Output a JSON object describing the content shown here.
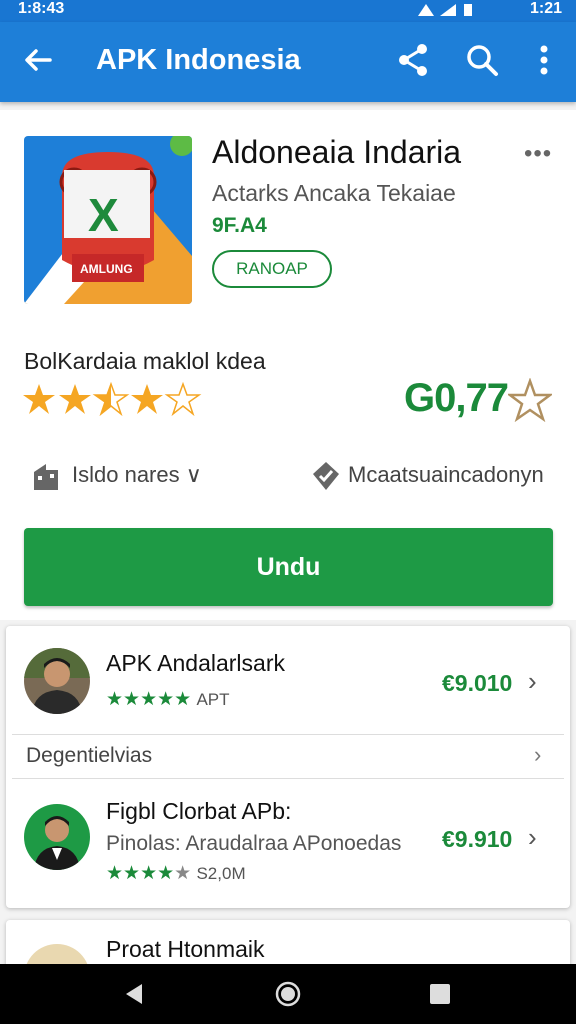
{
  "status_bar": {
    "time_left": "1:8:43",
    "time_right": "1:21",
    "icons": "wifi signal battery"
  },
  "app_bar": {
    "title": "APK Indonesia",
    "back_icon": "arrow-back-icon",
    "share_icon": "share-icon",
    "search_icon": "search-icon",
    "more_icon": "more-vert-icon",
    "color": "#1e7fd8"
  },
  "app": {
    "name": "Aldoneaia Indaria",
    "developer": "Actarks Ancaka Tekaiae",
    "size": "9F.A4",
    "badge": "RANOAP",
    "icon_label": "AMLUNG",
    "icon_letter": "X",
    "menu": "•••"
  },
  "rating": {
    "label": "BolKardaia maklol kdea",
    "stars_filled": 3.5,
    "stars_total": 5,
    "price": "G0,77"
  },
  "info": {
    "left": "Isldo nares",
    "left_caret": "∨",
    "right": "Mcaatsuaincadonyn"
  },
  "download_button": {
    "label": "Undu",
    "color": "#1e9a45"
  },
  "list": {
    "section_header": "Degentielvias",
    "items": [
      {
        "name": "APK Andalarlsark",
        "rating_meta": "APT",
        "stars": "★★★★★",
        "price": "€9.010"
      },
      {
        "name": "Figbl Clorbat APb:",
        "sub": "Pinolas: Araudalraa APonoedas",
        "stars": "★★★★",
        "stars_empty": "★",
        "rating_meta": "S2,0M",
        "price": "€9.910"
      }
    ],
    "peek_item": {
      "name": "Proat Htonmaik"
    }
  },
  "accent_green": "#1b8a3a"
}
